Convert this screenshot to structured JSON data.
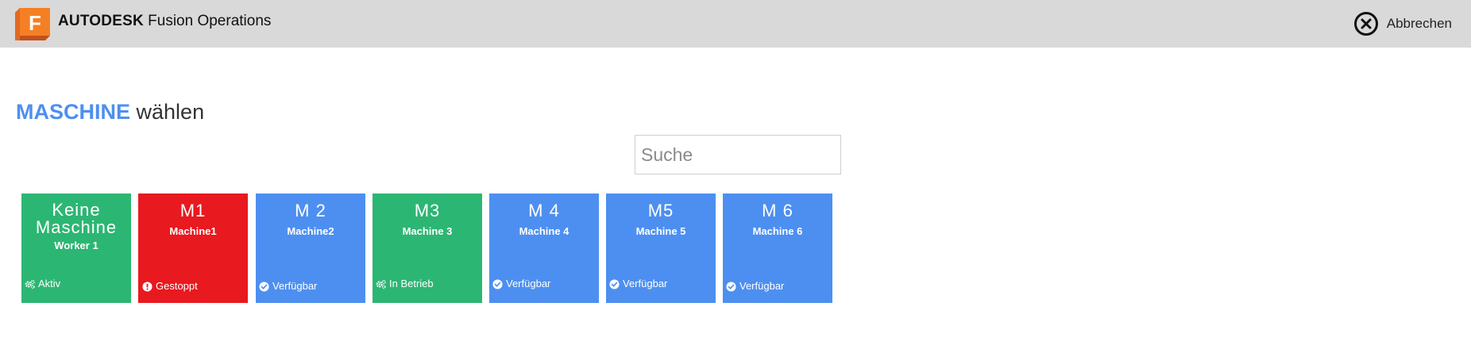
{
  "header": {
    "brand_bold": "AUTODESK",
    "brand_rest": "Fusion Operations",
    "logo_letter": "F",
    "cancel_label": "Abbrechen"
  },
  "page": {
    "title_highlight": "MASCHINE",
    "title_rest": "wählen",
    "search_placeholder": "Suche"
  },
  "machines": [
    {
      "code": "Keine Maschine",
      "name": "Worker 1",
      "status": "Aktiv",
      "status_icon": "gears-icon",
      "color": "#2cb673"
    },
    {
      "code": "M1",
      "name": "Machine1",
      "status": "Gestoppt",
      "status_icon": "exclamation-circle-icon",
      "color": "#e8191f"
    },
    {
      "code": "M 2",
      "name": "Machine2",
      "status": "Verfügbar",
      "status_icon": "check-circle-icon",
      "color": "#4d8ff0"
    },
    {
      "code": "M3",
      "name": "Machine 3",
      "status": "In Betrieb",
      "status_icon": "gears-icon",
      "color": "#2cb673"
    },
    {
      "code": "M 4",
      "name": "Machine 4",
      "status": "Verfügbar",
      "status_icon": "check-circle-icon",
      "color": "#4d8ff0"
    },
    {
      "code": "M5",
      "name": "Machine 5",
      "status": "Verfügbar",
      "status_icon": "check-circle-icon",
      "color": "#4d8ff0"
    },
    {
      "code": "M 6",
      "name": "Machine 6",
      "status": "Verfügbar",
      "status_icon": "check-circle-icon",
      "color": "#4d8ff0"
    }
  ]
}
